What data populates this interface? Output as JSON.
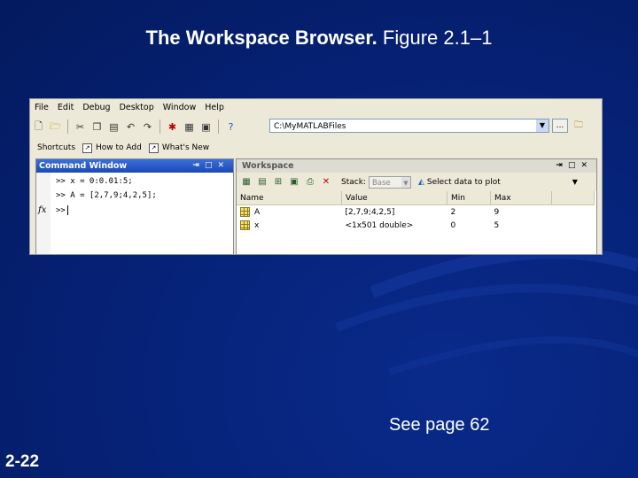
{
  "slide": {
    "title_bold": "The  Workspace Browser.",
    "title_rest": "Figure 2.1–1",
    "see_page": "See page 62",
    "slide_number": "2-22"
  },
  "matlab": {
    "menu": [
      "File",
      "Edit",
      "Debug",
      "Desktop",
      "Window",
      "Help"
    ],
    "toolbar_icons": [
      "new-file-icon",
      "open-folder-icon",
      "cut-icon",
      "copy-icon",
      "paste-icon",
      "undo-icon",
      "redo-icon",
      "simulink-icon",
      "guide-icon",
      "profiler-icon",
      "help-icon"
    ],
    "current_directory": "C:\\MyMATLABFiles",
    "dir_more_label": "...",
    "shortcuts": {
      "label": "Shortcuts",
      "items": [
        "How to Add",
        "What's New"
      ]
    },
    "command_window": {
      "title": "Command Window",
      "lines": [
        ">> x = 0:0.01:5;",
        ">> A = [2,7,9;4,2,5];",
        ">>"
      ],
      "fx_label": "fx"
    },
    "workspace": {
      "title": "Workspace",
      "stack_label": "Stack:",
      "stack_value": "Base",
      "plot_label": "Select data to plot",
      "columns": [
        "Name",
        "Value",
        "Min",
        "Max"
      ],
      "rows": [
        {
          "name": "A",
          "value": "[2,7,9;4,2,5]",
          "min": "2",
          "max": "9"
        },
        {
          "name": "x",
          "value": "<1x501 double>",
          "min": "0",
          "max": "5"
        }
      ]
    }
  }
}
